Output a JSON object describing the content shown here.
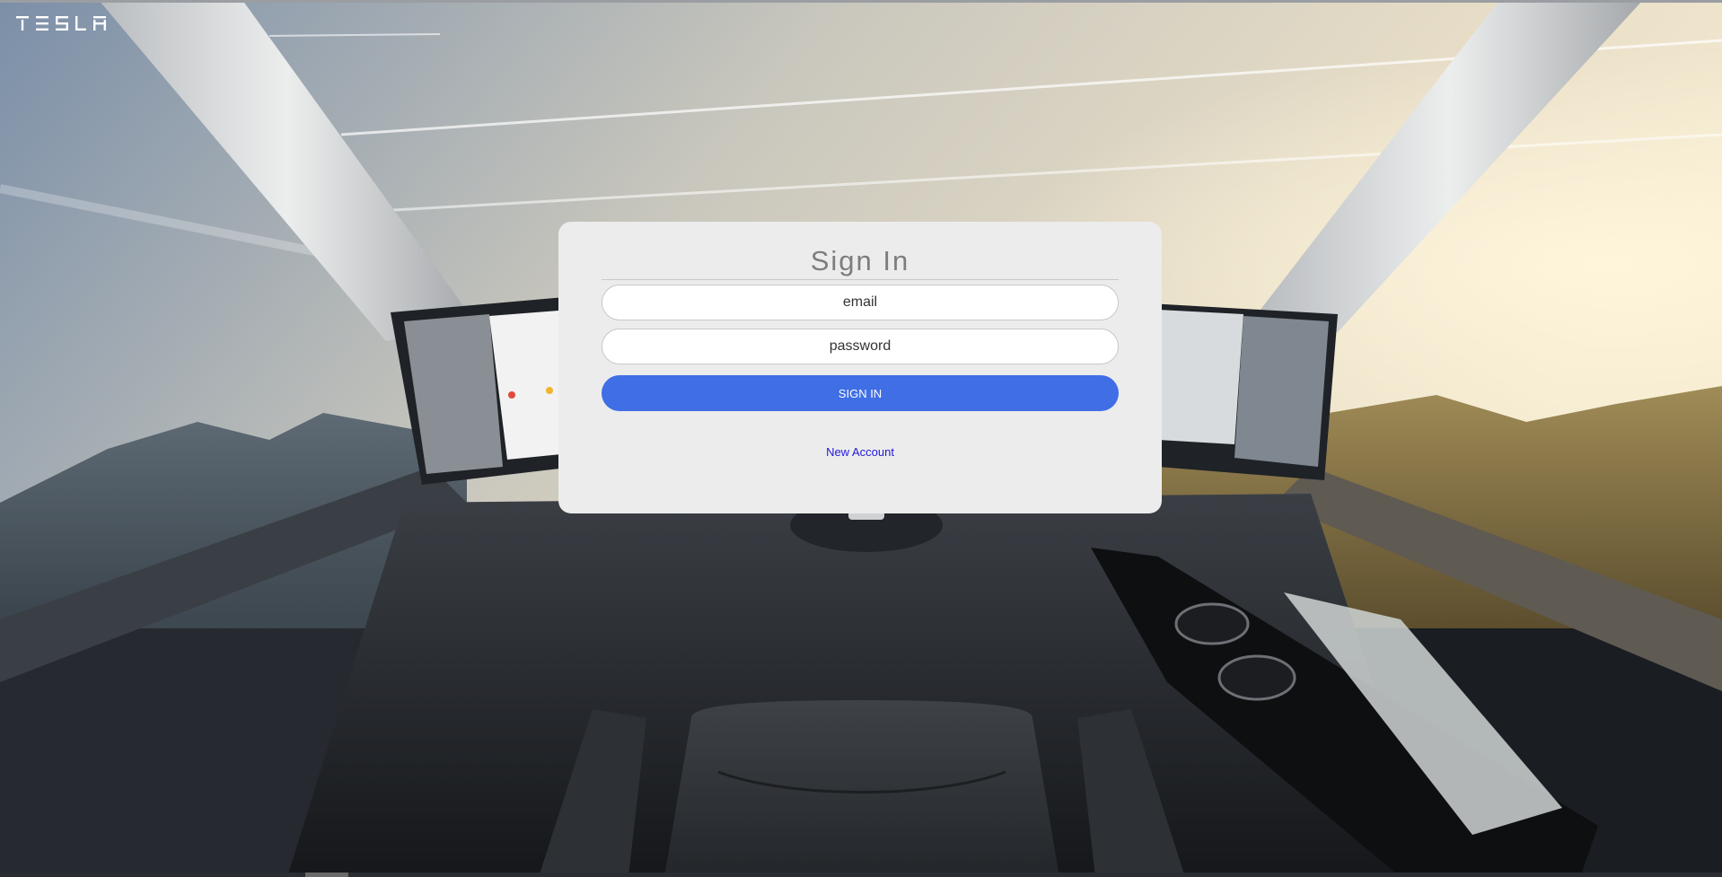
{
  "brand": {
    "logo_text": "TESLA"
  },
  "background": {
    "scene": "semi-truck-cab-interior"
  },
  "login": {
    "title": "Sign In",
    "email_placeholder": "email",
    "password_placeholder": "password",
    "submit_label": "SIGN IN",
    "new_account_label": "New Account"
  },
  "colors": {
    "card_bg": "#ececec",
    "button_bg": "#3f6ee5",
    "link": "#2219d8",
    "title": "#7d7d7d"
  }
}
